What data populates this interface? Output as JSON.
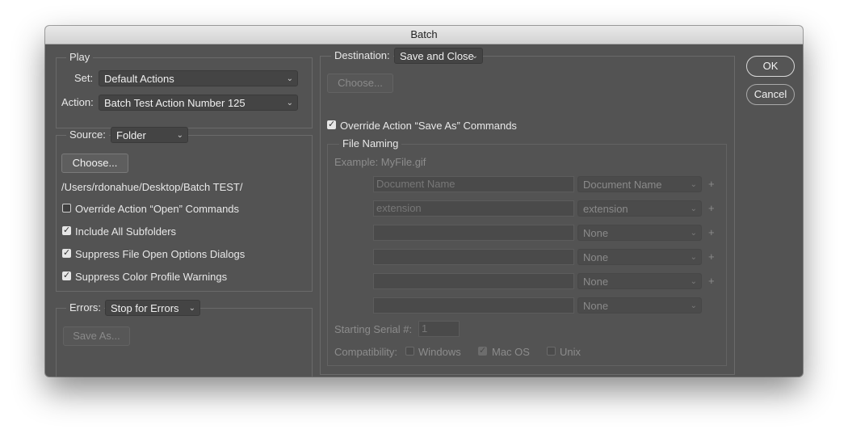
{
  "window": {
    "title": "Batch"
  },
  "play": {
    "legend": "Play",
    "set_label": "Set:",
    "set_value": "Default Actions",
    "action_label": "Action:",
    "action_value": "Batch Test Action Number 125"
  },
  "source": {
    "label": "Source:",
    "value": "Folder",
    "choose_label": "Choose...",
    "path": "/Users/rdonahue/Desktop/Batch TEST/",
    "options": [
      {
        "label": "Override Action “Open” Commands",
        "checked": false
      },
      {
        "label": "Include All Subfolders",
        "checked": true
      },
      {
        "label": "Suppress File Open Options Dialogs",
        "checked": true
      },
      {
        "label": "Suppress Color Profile Warnings",
        "checked": true
      }
    ]
  },
  "errors": {
    "label": "Errors:",
    "value": "Stop for Errors",
    "save_as_label": "Save As..."
  },
  "destination": {
    "label": "Destination:",
    "value": "Save and Close",
    "choose_label": "Choose...",
    "override_label": "Override Action “Save As” Commands",
    "override_checked": true
  },
  "file_naming": {
    "legend": "File Naming",
    "example": "Example: MyFile.gif",
    "rows": [
      {
        "text": "Document Name",
        "select": "Document Name"
      },
      {
        "text": "extension",
        "select": "extension"
      },
      {
        "text": "",
        "select": "None"
      },
      {
        "text": "",
        "select": "None"
      },
      {
        "text": "",
        "select": "None"
      },
      {
        "text": "",
        "select": "None"
      }
    ],
    "plus_symbol": "+",
    "serial_label": "Starting Serial #:",
    "serial_value": "1",
    "compat_label": "Compatibility:",
    "compat": [
      {
        "label": "Windows",
        "checked": false
      },
      {
        "label": "Mac OS",
        "checked": true
      },
      {
        "label": "Unix",
        "checked": false
      }
    ]
  },
  "buttons": {
    "ok": "OK",
    "cancel": "Cancel"
  },
  "icons": {
    "chevron": "chevron-down-icon",
    "check": "checkmark-icon"
  },
  "colors": {
    "panel": "#535353",
    "titlebar": "#dcdcdc"
  }
}
